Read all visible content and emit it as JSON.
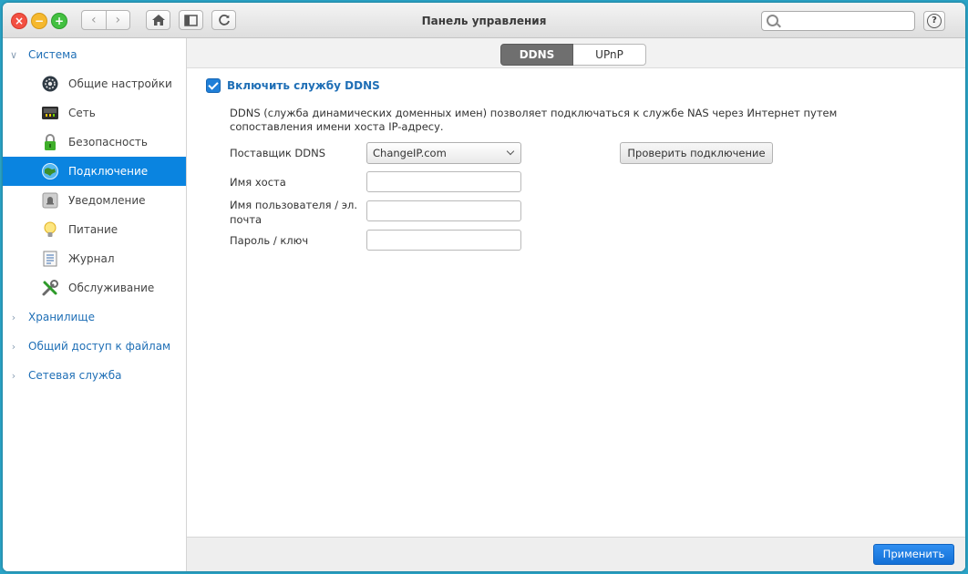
{
  "window": {
    "title": "Панель управления",
    "close_glyph": "×",
    "minimize_glyph": "−",
    "maximize_glyph": "+"
  },
  "toolbar": {
    "back_glyph": "‹",
    "forward_glyph": "›",
    "search_placeholder": "",
    "help_glyph": "?"
  },
  "sidebar": {
    "categories": [
      {
        "label": "Система",
        "chevron": "∨",
        "expanded": true
      },
      {
        "label": "Хранилище",
        "chevron": "›",
        "expanded": false
      },
      {
        "label": "Общий доступ к файлам",
        "chevron": "›",
        "expanded": false
      },
      {
        "label": "Сетевая служба",
        "chevron": "›",
        "expanded": false
      }
    ],
    "items": [
      {
        "label": "Общие настройки",
        "icon": "gear-icon"
      },
      {
        "label": "Сеть",
        "icon": "network-icon"
      },
      {
        "label": "Безопасность",
        "icon": "lock-icon"
      },
      {
        "label": "Подключение",
        "icon": "globe-icon",
        "active": true
      },
      {
        "label": "Уведомление",
        "icon": "bell-icon"
      },
      {
        "label": "Питание",
        "icon": "lightbulb-icon"
      },
      {
        "label": "Журнал",
        "icon": "log-icon"
      },
      {
        "label": "Обслуживание",
        "icon": "tools-icon"
      }
    ]
  },
  "tabs": [
    {
      "label": "DDNS",
      "active": true
    },
    {
      "label": "UPnP",
      "active": false
    }
  ],
  "ddns": {
    "enable_label": "Включить службу DDNS",
    "enabled": true,
    "description": "DDNS (служба динамических доменных имен) позволяет подключаться к службе NAS через Интернет путем сопоставления имени хоста IP-адресу.",
    "provider_label": "Поставщик DDNS",
    "provider_value": "ChangeIP.com",
    "check_button": "Проверить подключение",
    "hostname_label": "Имя хоста",
    "hostname_value": "",
    "username_label": "Имя пользователя / эл. почта",
    "username_value": "",
    "password_label": "Пароль / ключ",
    "password_value": ""
  },
  "footer": {
    "apply_label": "Применить"
  },
  "colors": {
    "accent": "#0a84e0",
    "category_text": "#1f6fb6",
    "desktop": "#2aa3c6",
    "apply_button": "#1f7fe0"
  }
}
